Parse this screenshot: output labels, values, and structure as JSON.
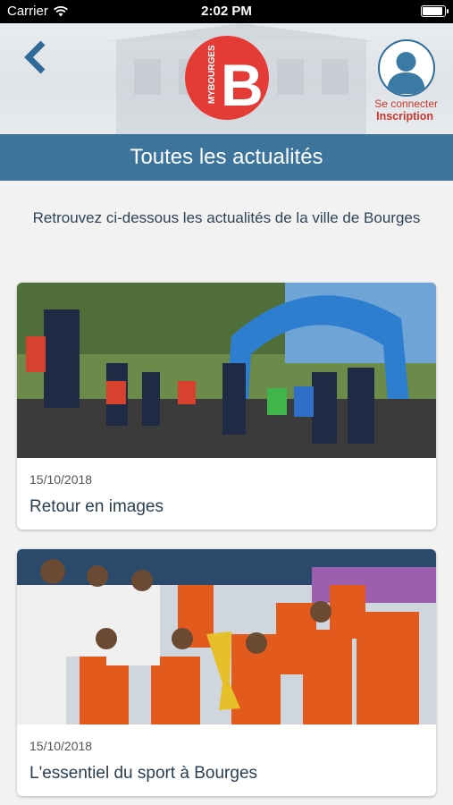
{
  "status_bar": {
    "carrier": "Carrier",
    "time": "2:02 PM",
    "battery_level": 0.95
  },
  "header": {
    "logo_text": "MYBOURGES",
    "logo_letter": "B",
    "login_label": "Se connecter",
    "signup_label": "Inscription"
  },
  "page": {
    "title": "Toutes les actualités",
    "intro": "Retrouvez ci-dessous les actualités de la ville de Bourges"
  },
  "news": [
    {
      "date": "15/10/2018",
      "title": "Retour en images"
    },
    {
      "date": "15/10/2018",
      "title": "L'essentiel du sport à Bourges"
    }
  ],
  "colors": {
    "brand_red": "#e43b37",
    "brand_blue": "#3d749b",
    "link_red": "#c8372d"
  }
}
